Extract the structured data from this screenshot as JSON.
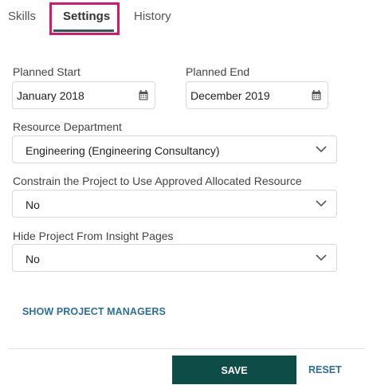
{
  "tabs": [
    {
      "label": "Skills"
    },
    {
      "label": "Settings"
    },
    {
      "label": "History"
    }
  ],
  "planned_start": {
    "label": "Planned Start",
    "value": "January 2018"
  },
  "planned_end": {
    "label": "Planned End",
    "value": "December 2019"
  },
  "resource_department": {
    "label": "Resource Department",
    "value": "Engineering (Engineering Consultancy)"
  },
  "constrain_project": {
    "label": "Constrain the Project to Use Approved Allocated Resource",
    "value": "No"
  },
  "hide_project": {
    "label": "Hide Project From Insight Pages",
    "value": "No"
  },
  "show_managers_label": "SHOW PROJECT MANAGERS",
  "footer": {
    "save_label": "SAVE",
    "reset_label": "RESET"
  },
  "colors": {
    "accent": "#0e4d47",
    "link": "#2a6f9e",
    "highlight": "#d6166f"
  },
  "icons": {
    "date": "calendar-icon",
    "dropdown": "chevron-down-icon"
  }
}
